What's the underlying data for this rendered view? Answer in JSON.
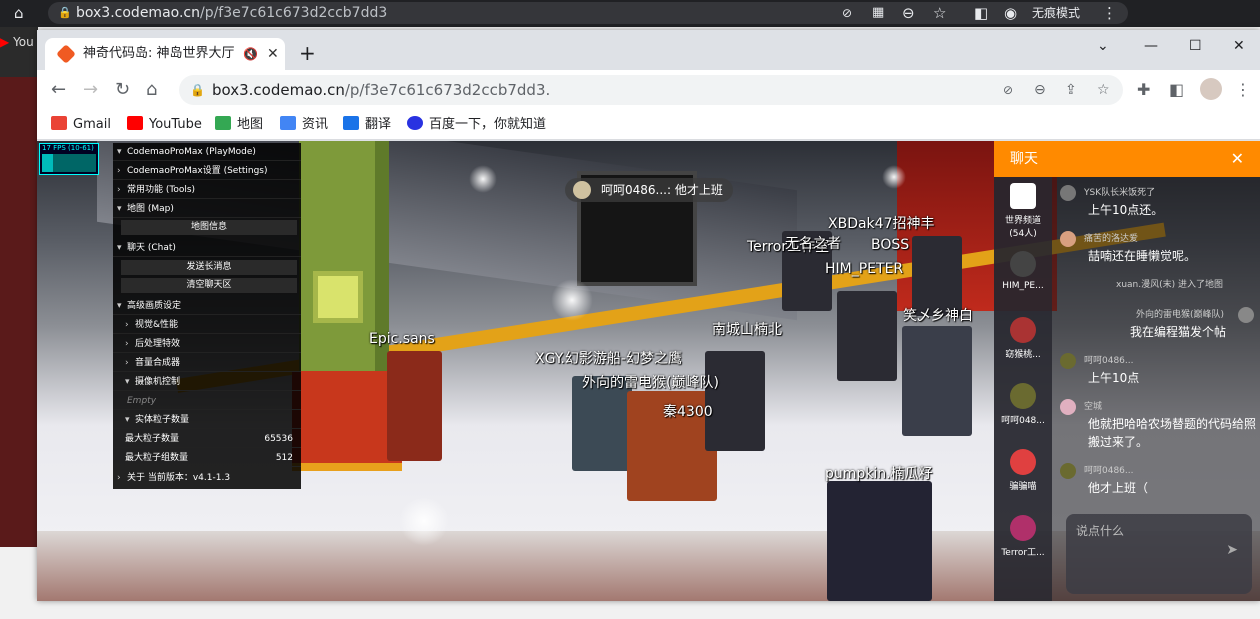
{
  "outer": {
    "url_domain": "box3.codemao.cn",
    "url_path": "/p/f3e7c61c673d2ccb7dd3",
    "incognito_label": "无痕模式",
    "tab_partial": "You"
  },
  "browser": {
    "tab_title": "神奇代码岛: 神岛世界大厅",
    "url_domain": "box3.codemao.cn",
    "url_path": "/p/f3e7c61c673d2ccb7dd3.",
    "bookmarks": [
      {
        "label": "Gmail",
        "color": "#ea4335"
      },
      {
        "label": "YouTube",
        "color": "#ff0000"
      },
      {
        "label": "地图",
        "color": "#34a853"
      },
      {
        "label": "资讯",
        "color": "#4285f4"
      },
      {
        "label": "翻译",
        "color": "#1a73e8"
      },
      {
        "label": "百度一下，你就知道",
        "color": "#2932e1"
      }
    ]
  },
  "game": {
    "fps": "17 FPS (10-61)",
    "menu": {
      "title": "CodemaoProMax (PlayMode)",
      "settings": "CodemaoProMax设置 (Settings)",
      "tools": "常用功能 (Tools)",
      "map": "地图 (Map)",
      "map_info": "地图信息",
      "chat": "聊天 (Chat)",
      "send_long": "发送长消息",
      "clear_chat": "清空聊天区",
      "advanced": "高级画质设定",
      "visual_perf": "视觉&性能",
      "post_effects": "后处理特效",
      "audio": "音量合成器",
      "camera": "摄像机控制",
      "empty": "Empty",
      "particles": "实体粒子数量",
      "max_particles_label": "最大粒子数量",
      "max_particles_value": "65536",
      "max_groups_label": "最大粒子组数量",
      "max_groups_value": "512",
      "version": "关于 当前版本：v4.1-1.3"
    },
    "bubble_text": "呵呵0486...: 他才上班",
    "nametags": [
      "Epic.sans",
      "XGY.幻影游船-幻梦之鹰",
      "外向的雷电猴(巅峰队)",
      "秦4300",
      "南城山楠北",
      "pumpkin.楠瓜籽",
      "HIM_PETER",
      "Terror工作室",
      "无名之者",
      "笑乄乡神白",
      "XBDak47招神丰",
      "BOSS"
    ]
  },
  "chat": {
    "title": "聊天",
    "channels": [
      {
        "label": "世界频道",
        "sub": "(54人)"
      },
      {
        "label": "HIM_PE..."
      },
      {
        "label": "窈猴桃..."
      },
      {
        "label": "呵呵048..."
      },
      {
        "label": "骗骗喵"
      },
      {
        "label": "Terror工..."
      }
    ],
    "messages": [
      {
        "name": "YSK队长米饭死了",
        "text": "上午10点还。"
      },
      {
        "name": "痛苦的洛达爱",
        "text": "喆喃还在睡懒觉呢。"
      },
      {
        "name": "xuan.漫风(末) 进入了地图",
        "text": ""
      },
      {
        "name": "外向的雷电猴(巅峰队)",
        "text": "我在编程猫发个帖"
      },
      {
        "name": "呵呵0486...",
        "text": "上午10点"
      },
      {
        "name": "空城",
        "text": "他就把哈哈农场替题的代码给照搬过来了。"
      },
      {
        "name": "呵呵0486...",
        "text": "他才上班（"
      }
    ],
    "input_placeholder": "说点什么"
  }
}
